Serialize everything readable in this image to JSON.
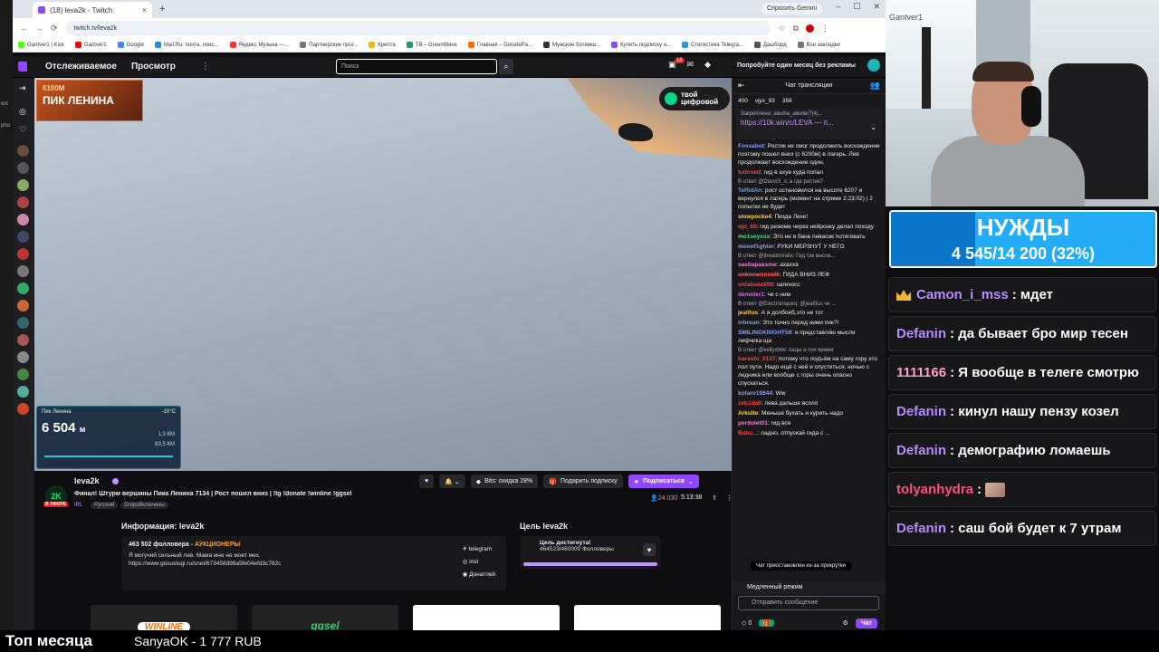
{
  "browser": {
    "tab_title": "(18) leva2k - Twitch",
    "new_tab": "+",
    "url": "twitch.tv/leva2k",
    "gemini": "Спросить Gemini",
    "bookmarks": [
      "Gantver1 | Kick",
      "Gantver1",
      "Google",
      "Mail.Ru: почта, поис...",
      "Яндекс Музыка —...",
      "Партнерские прог...",
      "Крипта",
      "TB – GreenWave",
      "Главная – DonatePa...",
      "Мужские ботинки...",
      "Купить подписку н...",
      "Статистика Telegra...",
      "Дашборд",
      "Все закладки"
    ],
    "bookmark_colors": [
      "#53fc18",
      "#ff0000",
      "#4285f4",
      "#168de2",
      "#ff3333",
      "#777777",
      "#f0b90b",
      "#1a9c5a",
      "#ff6b00",
      "#333333",
      "#9146ff",
      "#229ed9",
      "#555555",
      "#777777"
    ]
  },
  "twitch_nav": {
    "following": "Отслеживаемое",
    "browse": "Просмотр",
    "more": "⋮",
    "search_placeholder": "Поиск",
    "notif_count": "18",
    "ad_free": "Попробуйте один месяц без рекламы"
  },
  "video": {
    "brand_top": "6100М",
    "brand_main": "ПИК ЛЕНИНА",
    "tv_line1": "твой",
    "tv_line2": "цифровой",
    "hud_place": "Пик Ленина",
    "hud_temp": "-10°C",
    "hud_alt": "6 504",
    "hud_unit": "м",
    "hud_side1": "1,3 КМ",
    "hud_side2": "83,5 КМ"
  },
  "stream": {
    "channel": "leva2k",
    "avatar_text": "2K",
    "live": "В ЭФИРЕ",
    "title": "Финал! Штурм вершины Пика Ленина 7134 | Рост пошел вниз | !tg !donate !winline !ggsel",
    "category": "IRL",
    "tags": [
      "Русский",
      "DropsВключены"
    ],
    "bits_btn": "Bits: скидка 28%",
    "gift_btn": "Подарить подписку",
    "sub_btn": "Подписаться",
    "viewers": "24 030",
    "uptime": "5:13:38"
  },
  "about": {
    "title": "Информация: leva2k",
    "followers": "463 502",
    "followers_label": "фолловера",
    "followers_tag": "АУКЦИОНЕРЫ",
    "bio_line1": "Я могучий сильный лев. Мама мне не моет мех.",
    "bio_line2": "https://www.gosuslugi.ru/snet/673458d98a5fe04efd3c782c",
    "links": [
      "telegram",
      "inst",
      "Донатпей"
    ]
  },
  "goal": {
    "title": "Цель leva2k",
    "reached": "Цель достигнута!",
    "progress_text": "464523/460000 Фолловеры",
    "progress_fraction": 1.0
  },
  "panels": [
    "WINLINE",
    "ggsel",
    "",
    ""
  ],
  "chat": {
    "header": "Чат трансляции",
    "leader1": "400",
    "leader2": "vjyx_93",
    "leader3": "356",
    "pinned_label": "Закреплено: alesha_alexter7|4j...",
    "pinned_link": "https://10k.win/c/LEVA — п...",
    "paused": "Чат приостановлен из-за прокрутки",
    "slow_mode": "Медленный режим",
    "send_placeholder": "Отправить сообщение",
    "points": "0",
    "chat_btn": "Чат",
    "messages": [
      {
        "user": "Fossabot",
        "color": "#8a9bff",
        "text": "Ростик не смог продолжить восхождение поэтому пошел вниз (с 6200м) в лагерь. Лев продолжает восхождение один."
      },
      {
        "user": "ludoved",
        "color": "#ff4040",
        "text": "гид в ахуе куда попал"
      },
      {
        "reply": "В ответ @DavviS_s: а где ростик?",
        "user": "TeRidAn",
        "color": "#5aa0ff",
        "text": "рост остановился на высоте 6207 и вернулся в лагерь (момент на стриме 2:23:02) | 2 попытки не будет"
      },
      {
        "user": "slowpocke4",
        "color": "#ffd34e",
        "text": "Пизда Лехе!"
      },
      {
        "user": "opi_60",
        "color": "#ff4040",
        "text": "гид резюме через нейронку делал походу"
      },
      {
        "user": "mo1seyxxx",
        "color": "#4de38a",
        "text": "Это не в бане пивасик потягивать"
      },
      {
        "user": "moonf1ghter",
        "color": "#8a9bff",
        "text": "РУКИ МЕРЗНУТ У НЕГО"
      },
      {
        "reply": "В ответ @theadmiralix: Гид так высок...",
        "user": "sashapassme",
        "color": "#ff78e1",
        "text": "ахахха"
      },
      {
        "user": "unknownnnnik",
        "color": "#ff6b6b",
        "text": "ГИДА ВНИЗ ЛЕФ"
      },
      {
        "user": "oldaloaia999",
        "color": "#ff4040",
        "text": "sarevocc"
      },
      {
        "user": "demider1",
        "color": "#e35bff",
        "text": "че с ним"
      },
      {
        "reply": "В ответ @Electroniqueq: @jeal0us че ...",
        "user": "jeal0us",
        "color": "#ffc75a",
        "text": "А я долбоеб,это не тот"
      },
      {
        "user": "mbrean",
        "color": "#5fb0ff",
        "text": "Это точно перед ними пик?!"
      },
      {
        "user": "SMILINGKNIGHT58",
        "color": "#8a9bff",
        "text": "я представляю мысли лифчика ща"
      },
      {
        "reply": "В ответ @kellyxbtw: пацы а поч время",
        "user": "barashi_3137",
        "color": "#ff4040",
        "text": "потому что подъём на саму гору это пол пути. Надо ещё с неё и спуститься, ночью с ледника или вообще с горы очень опасно спускаться."
      },
      {
        "user": "kotaro19844",
        "color": "#8a9bff",
        "text": "Ww"
      },
      {
        "user": "zeb1da6",
        "color": "#ff4040",
        "text": "лева дальше всоло"
      },
      {
        "user": "Arkulte",
        "color": "#ffd34e",
        "text": "Меньше бухать и курить надо"
      },
      {
        "user": "perdolet01",
        "color": "#ff78e1",
        "text": "гид все"
      },
      {
        "user": "Babu...",
        "color": "#ff4040",
        "text": "ладно, отпускай гида с ..."
      }
    ]
  },
  "overlay": {
    "goal_title": "НУЖДЫ",
    "goal_value": "4 545/14 200 (32%)",
    "goal_fraction": 0.32,
    "webcam_logo": "Gantver1",
    "chat": [
      {
        "user": "Camon_i_mss",
        "color": "#b58cff",
        "text": "мдет",
        "crown": true
      },
      {
        "user": "Defanin",
        "color": "#b58cff",
        "text": "да бывает бро мир тесен"
      },
      {
        "user": "1111166",
        "color": "#ff9ecd",
        "text": "Я вообще в телеге смотрю"
      },
      {
        "user": "Defanin",
        "color": "#b58cff",
        "text": "кинул нашу пензу козел"
      },
      {
        "user": "Defanin",
        "color": "#b58cff",
        "text": "демографию ломаешь"
      },
      {
        "user": "tolyanhydra",
        "color": "#ff4f81",
        "text": "",
        "emote": true
      },
      {
        "user": "Defanin",
        "color": "#b58cff",
        "text": "саш бой будет к 7 утрам"
      }
    ]
  },
  "bottom": {
    "top_month": "Топ месяца",
    "top_donor": "SanyaOK - 1 777 RUB"
  },
  "os_dock_labels": [
    "ext",
    "pho"
  ]
}
